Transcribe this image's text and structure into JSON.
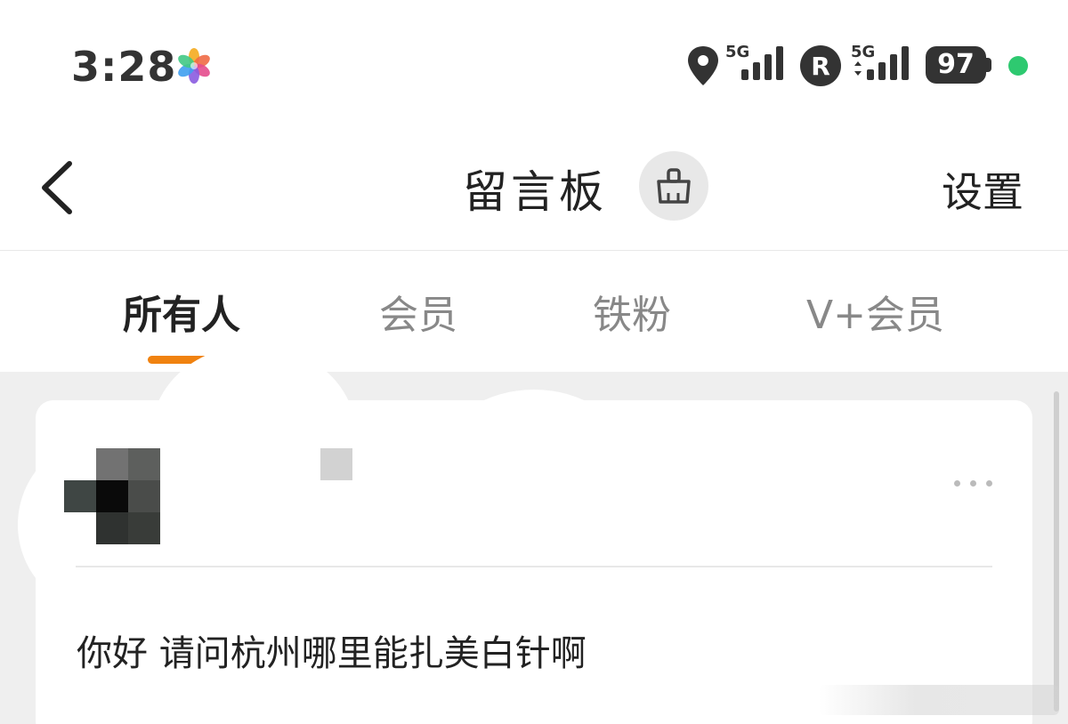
{
  "status_bar": {
    "time": "3:28",
    "network_1": "5G",
    "roaming_badge": "R",
    "network_2": "5G",
    "battery": "97",
    "indicator_color": "#2ec970"
  },
  "header": {
    "title": "留言板",
    "settings_label": "设置",
    "back_icon": "chevron-left-icon",
    "clean_icon": "broom-icon"
  },
  "tabs": [
    {
      "label": "所有人",
      "active": true
    },
    {
      "label": "会员",
      "active": false
    },
    {
      "label": "铁粉",
      "active": false
    },
    {
      "label": "V+会员",
      "active": false
    }
  ],
  "accent_color": "#f08210",
  "messages": [
    {
      "text": "你好 请问杭州哪里能扎美白针啊"
    }
  ]
}
